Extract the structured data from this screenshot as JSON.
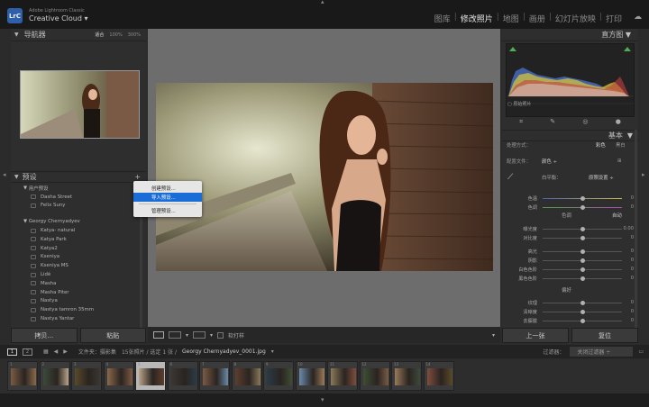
{
  "app": {
    "brand_small": "Adobe Lightroom Classic",
    "brand": "Creative Cloud",
    "logo": "LrC",
    "modules": [
      "图库",
      "修改照片",
      "地图",
      "画册",
      "幻灯片放映",
      "打印"
    ],
    "active_module": "修改照片",
    "separator": "|"
  },
  "navigator": {
    "title": "导航器",
    "zoom_levels": [
      "适合",
      "100%",
      "300%"
    ],
    "selected_zoom": "适合"
  },
  "presets": {
    "title": "预设",
    "add": "+",
    "groups": [
      {
        "name": "用户预设",
        "expanded": true,
        "items": [
          "Dasha Street",
          "Felix Suny"
        ]
      },
      {
        "name": "Georgy Chernyadyev",
        "expanded": true,
        "items": [
          "Katya- natural",
          "Katya Park",
          "Katya2",
          "Kseniya",
          "Kseniya MS",
          "Lidé",
          "Masha",
          "Masha Piter",
          "Nastya",
          "Nastya tamron 35mm",
          "Nastya Yantar"
        ]
      }
    ]
  },
  "context_menu": {
    "items": [
      "创建预设...",
      "导入预设...",
      "管理预设..."
    ],
    "highlighted": "导入预设..."
  },
  "left_buttons": {
    "copy": "拷贝...",
    "paste": "粘贴"
  },
  "right_panel": {
    "histogram_title": "直方图",
    "original_photo": "原始照片",
    "basic_title": "基本",
    "treatment_label": "处理方式：",
    "color": "彩色",
    "bw": "黑白",
    "profile_label": "配置文件：",
    "profile_value": "颜色",
    "wb_label": "白平衡：",
    "wb_value": "原照设置",
    "temp": "色温",
    "tint": "色调",
    "tone_title": "色调",
    "auto": "自动",
    "exposure": "曝光度",
    "exposure_val": "0.00",
    "contrast": "对比度",
    "highlights": "高光",
    "shadows": "阴影",
    "whites": "白色色阶",
    "blacks": "黑色色阶",
    "presence_title": "偏好",
    "texture": "纹理",
    "clarity": "清晰度",
    "dehaze": "去朦胧",
    "zero": "0",
    "prev_button": "上一张",
    "reset_button": "复位"
  },
  "toolbar": {
    "softproof": "软打样"
  },
  "filmstrip_bar": {
    "page1": "1",
    "page2": "2",
    "source": "文件夹：摄影集",
    "count": "15张照片 / 选定 1 张 /",
    "filename": "Georgy Chernyadyev_0001.jpg",
    "filter_label": "过滤器：",
    "filter_value": "关闭过滤器"
  },
  "filmstrip": {
    "numbers": [
      "1",
      "2",
      "3",
      "4",
      "5",
      "6",
      "7",
      "8",
      "9",
      "10",
      "11",
      "12",
      "13",
      "14"
    ],
    "selected_index": 4
  }
}
